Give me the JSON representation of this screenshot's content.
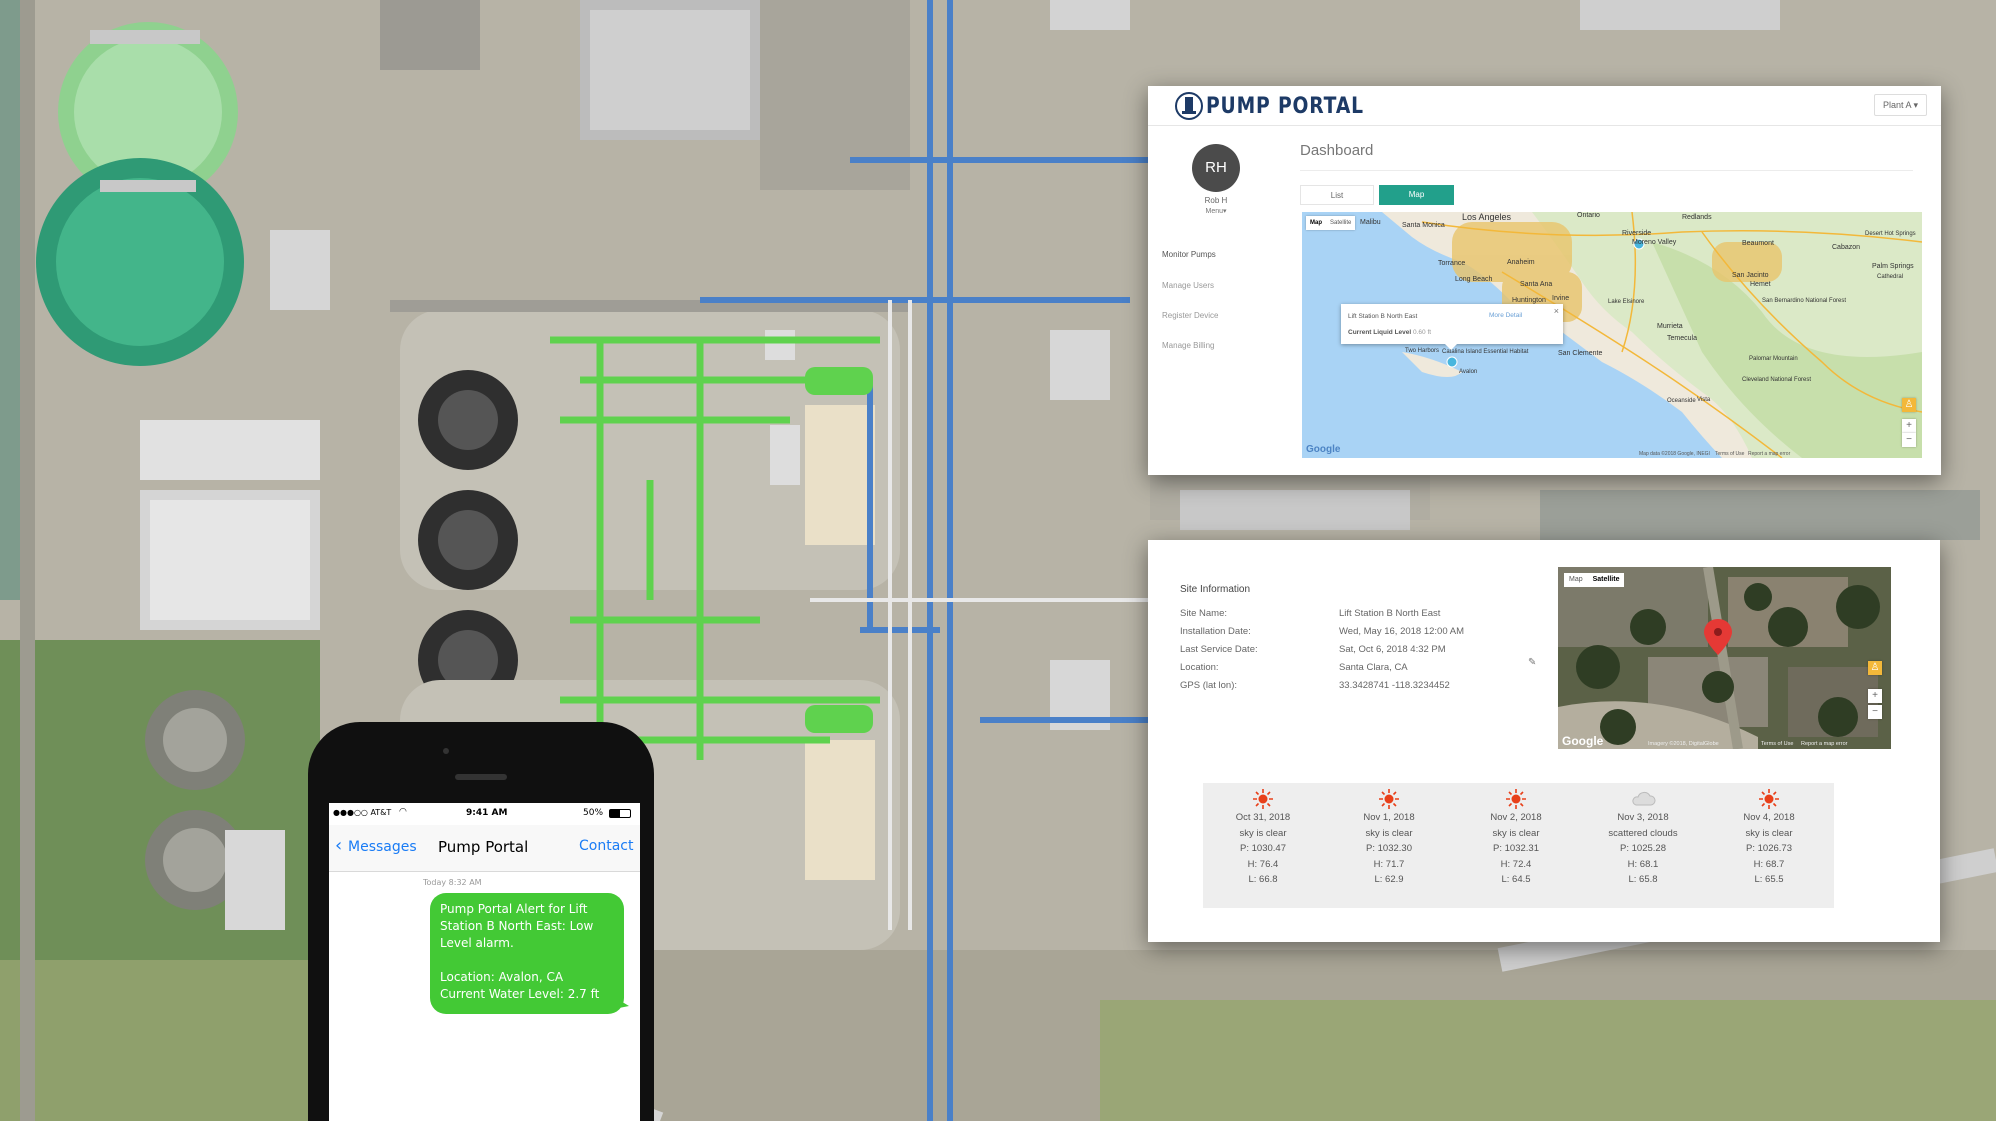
{
  "dashboard": {
    "brand": "PUMP PORTAL",
    "plant_select": "Plant A",
    "user": {
      "initials": "RH",
      "name": "Rob H",
      "menu": "Menu"
    },
    "nav": [
      "Monitor Pumps",
      "Manage Users",
      "Register Device",
      "Manage Billing"
    ],
    "title": "Dashboard",
    "tabs": {
      "list": "List",
      "map": "Map"
    },
    "map": {
      "type_buttons": [
        "Map",
        "Satellite"
      ],
      "places": [
        "Malibu",
        "Santa Monica",
        "Los Angeles",
        "Ontario",
        "Redlands",
        "Riverside",
        "Moreno Valley",
        "Beaumont",
        "Desert Hot Springs",
        "Cabazon",
        "Palm Springs",
        "Cathedral",
        "Torrance",
        "Anaheim",
        "San Jacinto",
        "Hemet",
        "Long Beach",
        "Santa Ana",
        "Huntington",
        "Irvine",
        "Lake Elsinore",
        "San Bernardino National Forest",
        "Murrieta",
        "Temecula",
        "Two Harbors",
        "Catalina Island Essential Habitat",
        "Avalon",
        "San Clemente",
        "Palomar Mountain",
        "Cleveland National Forest",
        "Oceanside",
        "Vista"
      ],
      "popup": {
        "site": "Lift Station B North East",
        "more": "More Detail",
        "level_label": "Current Liquid Level",
        "level_value": "0.60 ft"
      },
      "google": "Google",
      "footer": [
        "Map data ©2018 Google, INEGI",
        "Terms of Use",
        "Report a map error"
      ]
    }
  },
  "site": {
    "title": "Site Information",
    "fields": [
      {
        "label": "Site Name:",
        "value": "Lift Station B North East"
      },
      {
        "label": "Installation Date:",
        "value": "Wed, May 16, 2018 12:00 AM"
      },
      {
        "label": "Last Service Date:",
        "value": "Sat, Oct 6, 2018 4:32 PM"
      },
      {
        "label": "Location:",
        "value": "Santa Clara, CA"
      },
      {
        "label": "GPS (lat lon):",
        "value": "33.3428741 -118.3234452"
      }
    ],
    "satellite": {
      "buttons": [
        "Map",
        "Satellite"
      ],
      "google": "Google",
      "footer": [
        "Imagery ©2018, DigitalGlobe",
        "Terms of Use",
        "Report a map error"
      ]
    },
    "weather": [
      {
        "date": "Oct 31, 2018",
        "desc": "sky is clear",
        "p": "P: 1030.47",
        "h": "H: 76.4",
        "l": "L: 66.8",
        "icon": "sun-icon"
      },
      {
        "date": "Nov 1, 2018",
        "desc": "sky is clear",
        "p": "P: 1032.30",
        "h": "H: 71.7",
        "l": "L: 62.9",
        "icon": "sun-icon"
      },
      {
        "date": "Nov 2, 2018",
        "desc": "sky is clear",
        "p": "P: 1032.31",
        "h": "H: 72.4",
        "l": "L: 64.5",
        "icon": "sun-icon"
      },
      {
        "date": "Nov 3, 2018",
        "desc": "scattered clouds",
        "p": "P: 1025.28",
        "h": "H: 68.1",
        "l": "L: 65.8",
        "icon": "cloud-icon"
      },
      {
        "date": "Nov 4, 2018",
        "desc": "sky is clear",
        "p": "P: 1026.73",
        "h": "H: 68.7",
        "l": "L: 65.5",
        "icon": "sun-icon"
      }
    ]
  },
  "phone": {
    "carrier": "●●●○○ AT&T",
    "time": "9:41 AM",
    "battery": "50%",
    "back": "Messages",
    "title": "Pump Portal",
    "contact": "Contact",
    "timestamp": "Today 8:32 AM",
    "message_lines": [
      "Pump Portal Alert for Lift",
      "Station B North East: Low",
      "Level alarm.",
      "",
      "Location: Avalon, CA",
      "Current Water Level: 2.7 ft"
    ]
  },
  "colors": {
    "accent": "#22a08b",
    "brand": "#1d3a66",
    "bubble": "#43c935",
    "ios_blue": "#1a7cf5"
  }
}
